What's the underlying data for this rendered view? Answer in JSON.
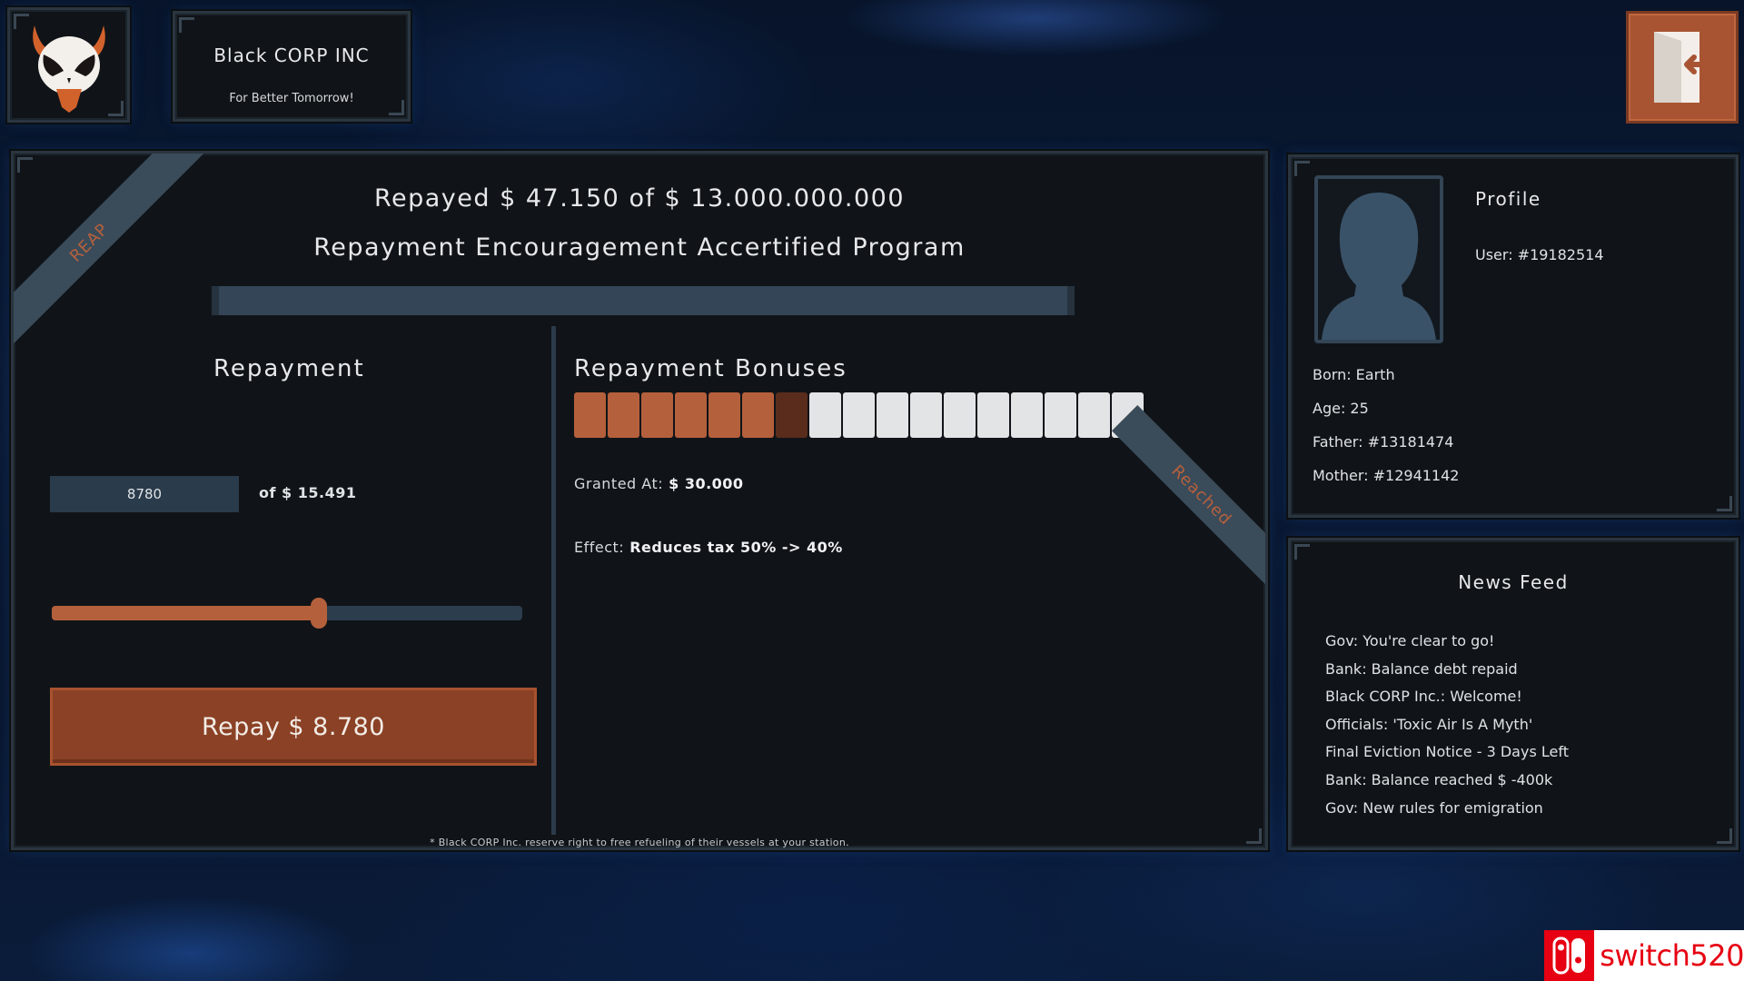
{
  "company": {
    "name": "Black CORP INC",
    "tagline": "For Better Tomorrow!"
  },
  "header": {
    "logo_icon": "devil-skull-icon",
    "exit_icon": "exit-door-icon"
  },
  "main": {
    "ribbon_label": "REAP",
    "repayed_line": "Repayed $ 47.150 of $ 13.000.000.000",
    "program_title": "Repayment Encouragement Accertified Program",
    "total_progress": 0.0
  },
  "repayment": {
    "heading": "Repayment",
    "amount_value": "8780",
    "amount_of": "of $ 15.491",
    "slider_fraction": 0.567,
    "button_label": "Repay $ 8.780"
  },
  "bonuses": {
    "heading": "Repayment Bonuses",
    "blocks_filled": 6,
    "blocks_current": 1,
    "blocks_total": 17,
    "granted_label": "Granted At:",
    "granted_value": "$ 30.000",
    "effect_label": "Effect:",
    "effect_value": "Reduces tax 50% -> 40%",
    "ribbon_label": "Reached"
  },
  "disclaimer": "* Black CORP Inc. reserve right to free refueling of their vessels at your station.",
  "profile": {
    "heading": "Profile",
    "user": "User: #19182514",
    "born": "Born: Earth",
    "age": "Age: 25",
    "father": "Father: #13181474",
    "mother": "Mother: #12941142",
    "avatar_icon": "person-silhouette-icon"
  },
  "news": {
    "heading": "News Feed",
    "items": [
      "Gov: You're clear to go!",
      "Bank: Balance debt repaid",
      "Black CORP Inc.: Welcome!",
      "Officials: 'Toxic Air Is A Myth'",
      "Final Eviction Notice - 3 Days Left",
      "Bank: Balance reached $ -400k",
      "Gov: New rules for emigration"
    ]
  },
  "watermark": {
    "text": "switch520",
    "icon": "nintendo-switch-logo-icon"
  },
  "colors": {
    "accent": "#b5603c",
    "panel": "#101418",
    "track": "#2c3d4d",
    "button": "#8b4125"
  }
}
